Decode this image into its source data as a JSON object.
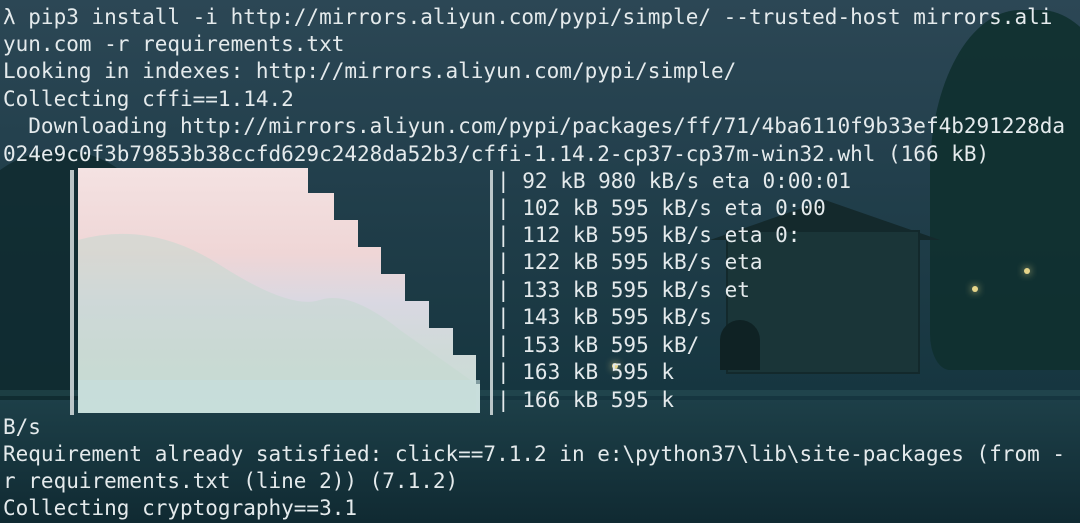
{
  "terminal": {
    "lines": [
      "λ pip3 install -i http://mirrors.aliyun.com/pypi/simple/ --trusted-host mirrors.ali",
      "yun.com -r requirements.txt",
      "Looking in indexes: http://mirrors.aliyun.com/pypi/simple/",
      "Collecting cffi==1.14.2",
      "  Downloading http://mirrors.aliyun.com/pypi/packages/ff/71/4ba6110f9b33ef4b291228da",
      "024e9c0f3b79853b38ccfd629c2428da52b3/cffi-1.14.2-cp37-cp37m-win32.whl (166 kB)"
    ],
    "progress_stats": [
      "| 92 kB 980 kB/s eta 0:00:01",
      "| 102 kB 595 kB/s eta 0:00",
      "| 112 kB 595 kB/s eta 0:",
      "| 122 kB 595 kB/s eta",
      "| 133 kB 595 kB/s et",
      "| 143 kB 595 kB/s",
      "| 153 kB 595 kB/",
      "| 163 kB 595 k",
      "| 166 kB 595 k"
    ],
    "after_lines": [
      "B/s",
      "Requirement already satisfied: click==7.1.2 in e:\\python37\\lib\\site-packages (from -",
      "r requirements.txt (line 2)) (7.1.2)",
      "Collecting cryptography==3.1"
    ]
  }
}
